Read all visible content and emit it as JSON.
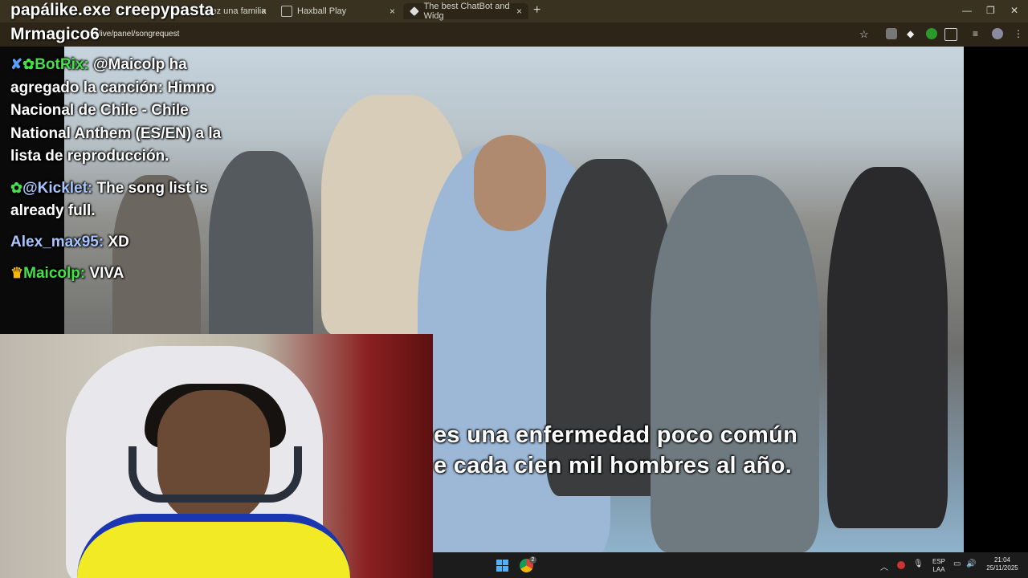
{
  "overlay": {
    "stream_title": "papálike.exe creepypasta",
    "streamer_name": "Mrmagico6"
  },
  "browser": {
    "tabs": [
      {
        "label": "vez una familia"
      },
      {
        "label": "Haxball Play"
      },
      {
        "label": "The best ChatBot and Widg"
      }
    ],
    "new_tab": "+",
    "close_glyph": "×",
    "url": "rix.live/panel/songrequest",
    "window_controls": {
      "minimize": "—",
      "maximize": "❐",
      "close": "✕"
    }
  },
  "chat": {
    "messages": [
      {
        "user": "BotRix:",
        "text": "@Maicolp ha agregado la canción: Himno Nacional de Chile - Chile National Anthem (ES/EN) a la lista de reproducción.",
        "user_color": "#46e04a",
        "badges": [
          "sword-icon",
          "verified-icon"
        ]
      },
      {
        "user": "@Kicklet:",
        "text": "The song list is already full.",
        "user_color": "#a9c5ff",
        "badges": [
          "verified-icon"
        ]
      },
      {
        "user": "Alex_max95:",
        "text": "XD",
        "user_color": "#a9c5ff",
        "badges": []
      },
      {
        "user": "Maicolp:",
        "text": "VIVA",
        "user_color": "#46e04a",
        "badges": [
          "crown-icon"
        ]
      }
    ]
  },
  "video": {
    "subtitle_line1": "es una enfermedad poco común",
    "subtitle_line2": "e cada cien mil hombres al año."
  },
  "taskbar": {
    "language_line1": "ESP",
    "language_line2": "LAA",
    "time": "21:04",
    "date": "25/11/2025",
    "notification_count": "2"
  },
  "colors": {
    "chrome_bg": "#3a3220",
    "username_green": "#46e04a",
    "username_blue": "#a9c5ff"
  }
}
